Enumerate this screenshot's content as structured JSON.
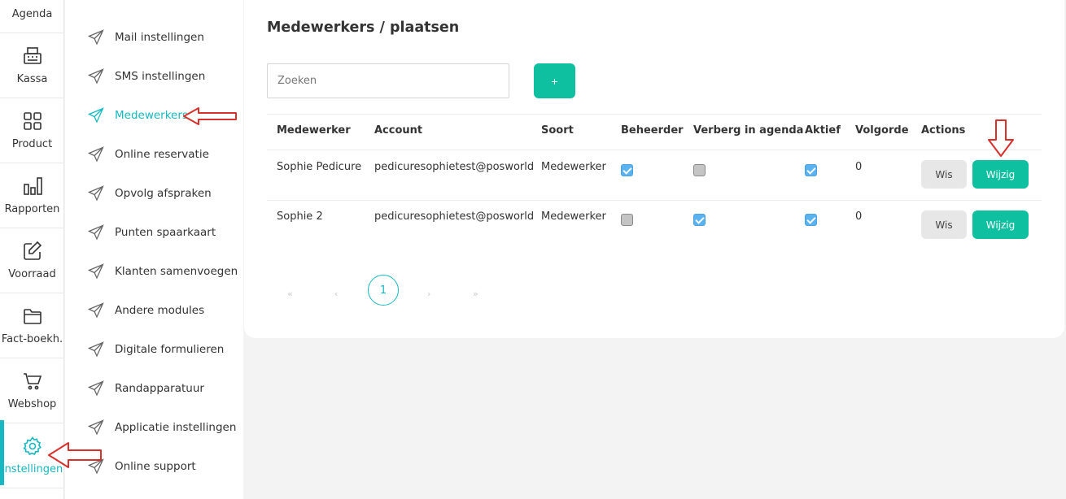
{
  "rail": {
    "items": [
      {
        "label": "Agenda",
        "icon": "calendar-icon"
      },
      {
        "label": "Kassa",
        "icon": "cash-register-icon"
      },
      {
        "label": "Product",
        "icon": "grid-icon"
      },
      {
        "label": "Rapporten",
        "icon": "bar-chart-icon"
      },
      {
        "label": "Voorraad",
        "icon": "edit-icon"
      },
      {
        "label": "Fact-boekh.",
        "icon": "folder-icon"
      },
      {
        "label": "Webshop",
        "icon": "cart-icon"
      },
      {
        "label": "Instellingen",
        "icon": "gear-icon",
        "active": true
      }
    ]
  },
  "submenu": {
    "items": [
      {
        "label": "Mail instellingen"
      },
      {
        "label": "SMS instellingen"
      },
      {
        "label": "Medewerkers",
        "active": true
      },
      {
        "label": "Online reservatie"
      },
      {
        "label": "Opvolg afspraken"
      },
      {
        "label": "Punten spaarkaart"
      },
      {
        "label": "Klanten samenvoegen"
      },
      {
        "label": "Andere modules"
      },
      {
        "label": "Digitale formulieren"
      },
      {
        "label": "Randapparatuur"
      },
      {
        "label": "Applicatie instellingen"
      },
      {
        "label": "Online support"
      }
    ]
  },
  "main": {
    "title": "Medewerkers / plaatsen",
    "search_placeholder": "Zoeken",
    "add_label": "+",
    "columns": [
      "Medewerker",
      "Account",
      "Soort",
      "Beheerder",
      "Verberg in agenda",
      "Aktief",
      "Volgorde",
      "Actions"
    ],
    "rows": [
      {
        "medewerker": "Sophie Pedicure",
        "account": "pedicuresophietest@posworld",
        "soort": "Medewerker",
        "beheerder": true,
        "verberg": false,
        "aktief": true,
        "volgorde": "0",
        "delete_label": "Wis",
        "edit_label": "Wijzig"
      },
      {
        "medewerker": "Sophie 2",
        "account": "pedicuresophietest@posworld",
        "soort": "Medewerker",
        "beheerder": false,
        "verberg": true,
        "aktief": true,
        "volgorde": "0",
        "delete_label": "Wis",
        "edit_label": "Wijzig"
      }
    ],
    "pagination": {
      "first": "«",
      "prev": "‹",
      "current": "1",
      "next": "›",
      "last": "»"
    }
  },
  "colors": {
    "accent": "#17b8c1",
    "primary_button": "#0fc0a0",
    "annotation_arrow": "#d9302c"
  }
}
